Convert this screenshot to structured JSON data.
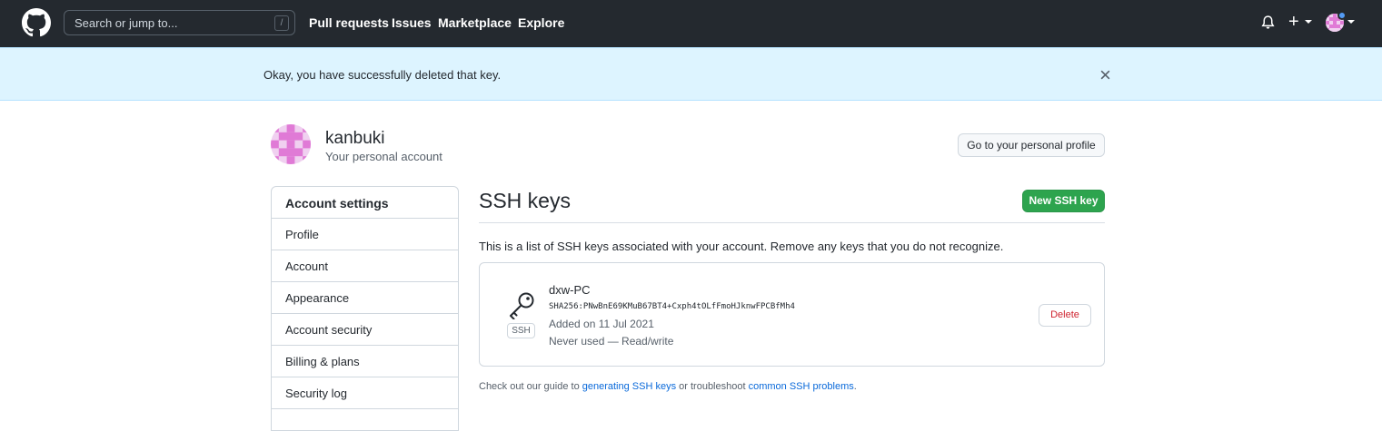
{
  "header": {
    "search_placeholder": "Search or jump to...",
    "search_shortcut": "/",
    "nav": [
      "Pull requests",
      "Issues",
      "Marketplace",
      "Explore"
    ],
    "plus_label": "+"
  },
  "flash": {
    "message": "Okay, you have successfully deleted that key."
  },
  "account": {
    "name": "kanbuki",
    "subtitle": "Your personal account",
    "profile_button": "Go to your personal profile"
  },
  "sidebar": {
    "heading": "Account settings",
    "items": [
      "Profile",
      "Account",
      "Appearance",
      "Account security",
      "Billing & plans",
      "Security log"
    ]
  },
  "main": {
    "title": "SSH keys",
    "new_button": "New SSH key",
    "description": "This is a list of SSH keys associated with your account. Remove any keys that you do not recognize.",
    "key": {
      "name": "dxw-PC",
      "badge": "SSH",
      "fingerprint": "SHA256:PNwBnE69KMuB67BT4+Cxph4tOLfFmoHJknwFPCBfMh4",
      "added": "Added on 11 Jul 2021",
      "usage": "Never used — Read/write",
      "delete_button": "Delete"
    },
    "footer": {
      "prefix": "Check out our guide to ",
      "link1": "generating SSH keys",
      "middle": " or troubleshoot ",
      "link2": "common SSH problems",
      "suffix": "."
    }
  },
  "colors": {
    "header_bg": "#24292f",
    "flash_bg": "#ddf4ff",
    "primary_button": "#2da44e",
    "danger": "#cf222e",
    "link": "#0969da"
  }
}
